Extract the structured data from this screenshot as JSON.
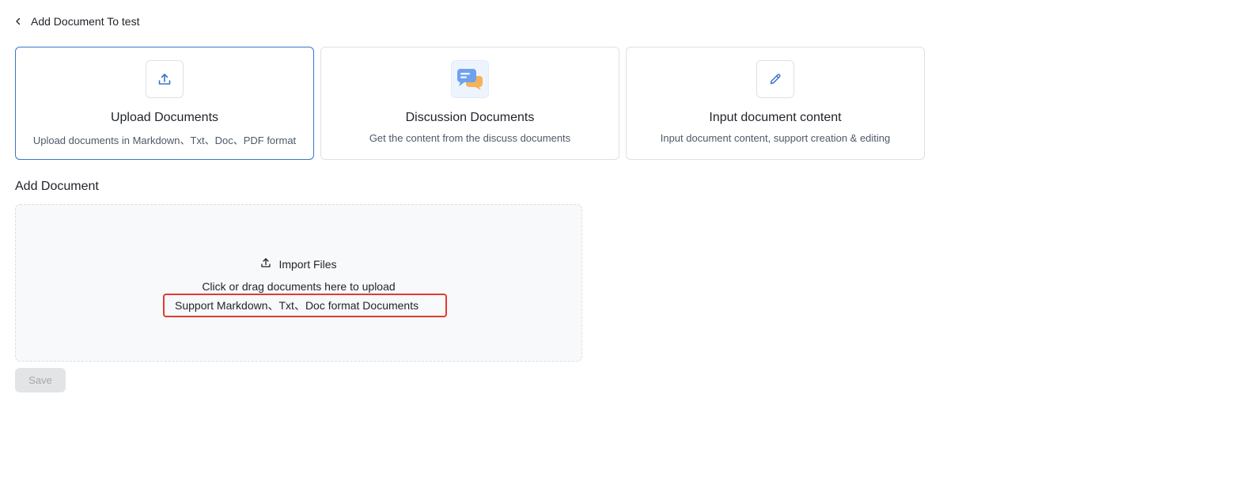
{
  "header": {
    "back_title": "Add Document To test",
    "back_icon": "chevron-left-icon"
  },
  "cards": [
    {
      "title": "Upload Documents",
      "description": "Upload documents in Markdown、Txt、Doc、PDF format",
      "icon": "upload-icon",
      "selected": true
    },
    {
      "title": "Discussion Documents",
      "description": "Get the content from the discuss documents",
      "icon": "chat-bubbles-icon",
      "selected": false
    },
    {
      "title": "Input document content",
      "description": "Input document content, support creation & editing",
      "icon": "pencil-icon",
      "selected": false
    }
  ],
  "section": {
    "title": "Add Document"
  },
  "dropzone": {
    "import_label": "Import Files",
    "import_icon": "upload-icon",
    "hint": "Click or drag documents here to upload",
    "support": "Support Markdown、Txt、Doc format Documents"
  },
  "actions": {
    "save_label": "Save",
    "save_disabled": true
  },
  "colors": {
    "accent": "#3b75c9",
    "highlight_border": "#e03b33",
    "dropzone_bg": "#f8f9fa",
    "disabled_button_bg": "#e3e4e6"
  }
}
